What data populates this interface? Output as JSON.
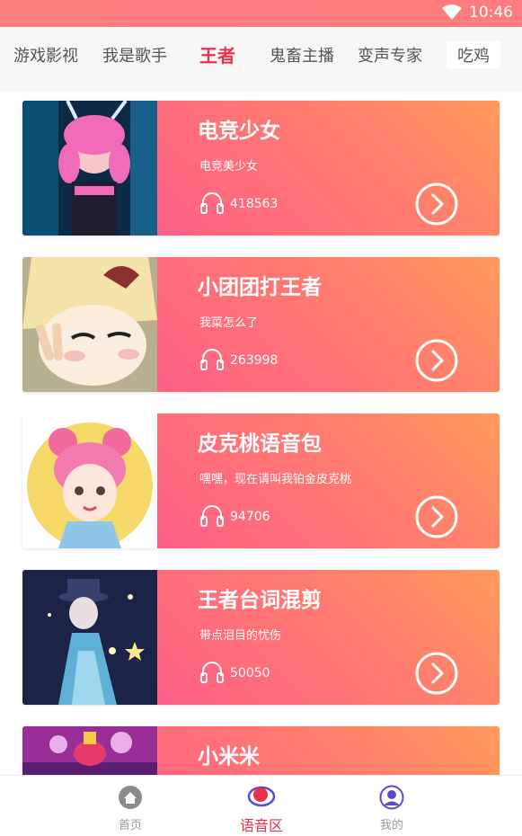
{
  "status_bar": {
    "time": "10:46"
  },
  "tabs": [
    {
      "label": "游戏影视"
    },
    {
      "label": "我是歌手"
    },
    {
      "label": "王者",
      "active": true
    },
    {
      "label": "鬼畜主播"
    },
    {
      "label": "变声专家"
    },
    {
      "label": "吃鸡"
    }
  ],
  "cards": [
    {
      "title": "电竞少女",
      "desc": "电竞美少女",
      "plays": "418563"
    },
    {
      "title": "小团团打王者",
      "desc": "我菜怎么了",
      "plays": "263998"
    },
    {
      "title": "皮克桃语音包",
      "desc": "嘿嘿，现在请叫我铂金皮克桃",
      "plays": "94706"
    },
    {
      "title": "王者台词混剪",
      "desc": "带点泪目的忧伤",
      "plays": "50050"
    },
    {
      "title": "小米米",
      "desc": "",
      "plays": ""
    }
  ],
  "bottom_nav": {
    "home": "首页",
    "voice": "语音区",
    "mine": "我的"
  },
  "colors": {
    "accent": "#e8304a",
    "card_gradient_start": "#ff9a5b",
    "card_gradient_end": "#ff5f86",
    "status_bar": "#ff7e7e"
  },
  "icons": [
    "wifi-icon",
    "headphones-icon",
    "chevron-right-circle-icon",
    "home-icon",
    "voice-zone-icon",
    "profile-icon"
  ]
}
